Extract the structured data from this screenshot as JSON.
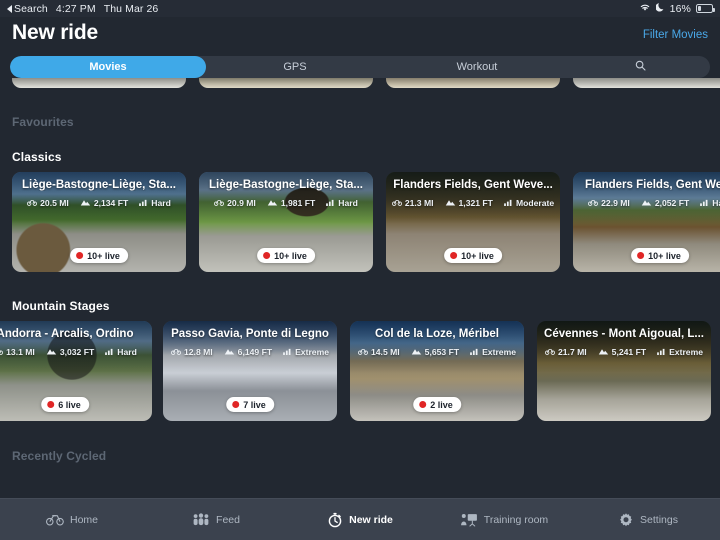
{
  "status_bar": {
    "back_label": "Search",
    "time": "4:27 PM",
    "date": "Thu Mar 26",
    "wifi_icon": "wifi-icon",
    "dnd_icon": "moon-icon",
    "battery_percent": "16%",
    "battery_icon": "battery-low-icon"
  },
  "header": {
    "title": "New ride",
    "filter_label": "Filter Movies"
  },
  "segmented": {
    "items": [
      {
        "label": "Movies",
        "selected": true
      },
      {
        "label": "GPS",
        "selected": false
      },
      {
        "label": "Workout",
        "selected": false
      }
    ],
    "search_icon": "search-icon"
  },
  "sections": [
    {
      "title": "Favourites",
      "state": "dim"
    },
    {
      "title": "Classics",
      "state": "bright"
    },
    {
      "title": "Mountain Stages",
      "state": "bright"
    },
    {
      "title": "Recently Cycled",
      "state": "dim"
    }
  ],
  "classics_cards": [
    {
      "title": "Liège-Bastogne-Liège, Sta...",
      "distance": "20.5 MI",
      "elevation": "2,134 FT",
      "difficulty": "Hard",
      "live": "10+ live"
    },
    {
      "title": "Liège-Bastogne-Liège, Sta...",
      "distance": "20.9 MI",
      "elevation": "1,981 FT",
      "difficulty": "Hard",
      "live": "10+ live"
    },
    {
      "title": "Flanders Fields, Gent Weve...",
      "distance": "21.3 MI",
      "elevation": "1,321 FT",
      "difficulty": "Moderate",
      "live": "10+ live"
    },
    {
      "title": "Flanders Fields, Gent Weve",
      "distance": "22.9 MI",
      "elevation": "2,052 FT",
      "difficulty": "Hard",
      "live": "10+ live"
    }
  ],
  "mountain_cards": [
    {
      "title": "Andorra - Arcalis, Ordino",
      "distance": "13.1 MI",
      "elevation": "3,032 FT",
      "difficulty": "Hard",
      "live": "6 live"
    },
    {
      "title": "Passo Gavia, Ponte di Legno",
      "distance": "12.8 MI",
      "elevation": "6,149 FT",
      "difficulty": "Extreme",
      "live": "7 live"
    },
    {
      "title": "Col de la Loze, Méribel",
      "distance": "14.5 MI",
      "elevation": "5,653 FT",
      "difficulty": "Extreme",
      "live": "2 live"
    },
    {
      "title": "Cévennes - Mont Aigoual, L...",
      "distance": "21.7 MI",
      "elevation": "5,241 FT",
      "difficulty": "Extreme",
      "live": ""
    }
  ],
  "tab_bar": {
    "items": [
      {
        "label": "Home",
        "icon": "bicycle-icon",
        "active": false
      },
      {
        "label": "Feed",
        "icon": "people-icon",
        "active": false
      },
      {
        "label": "New ride",
        "icon": "stopwatch-icon",
        "active": true
      },
      {
        "label": "Training room",
        "icon": "presentation-icon",
        "active": false
      },
      {
        "label": "Settings",
        "icon": "gear-icon",
        "active": false
      }
    ]
  },
  "colors": {
    "background": "#222831",
    "accent": "#3fa9e8",
    "link": "#4aa8e8",
    "tabbar": "#3b424e",
    "live_dot": "#e02626"
  }
}
